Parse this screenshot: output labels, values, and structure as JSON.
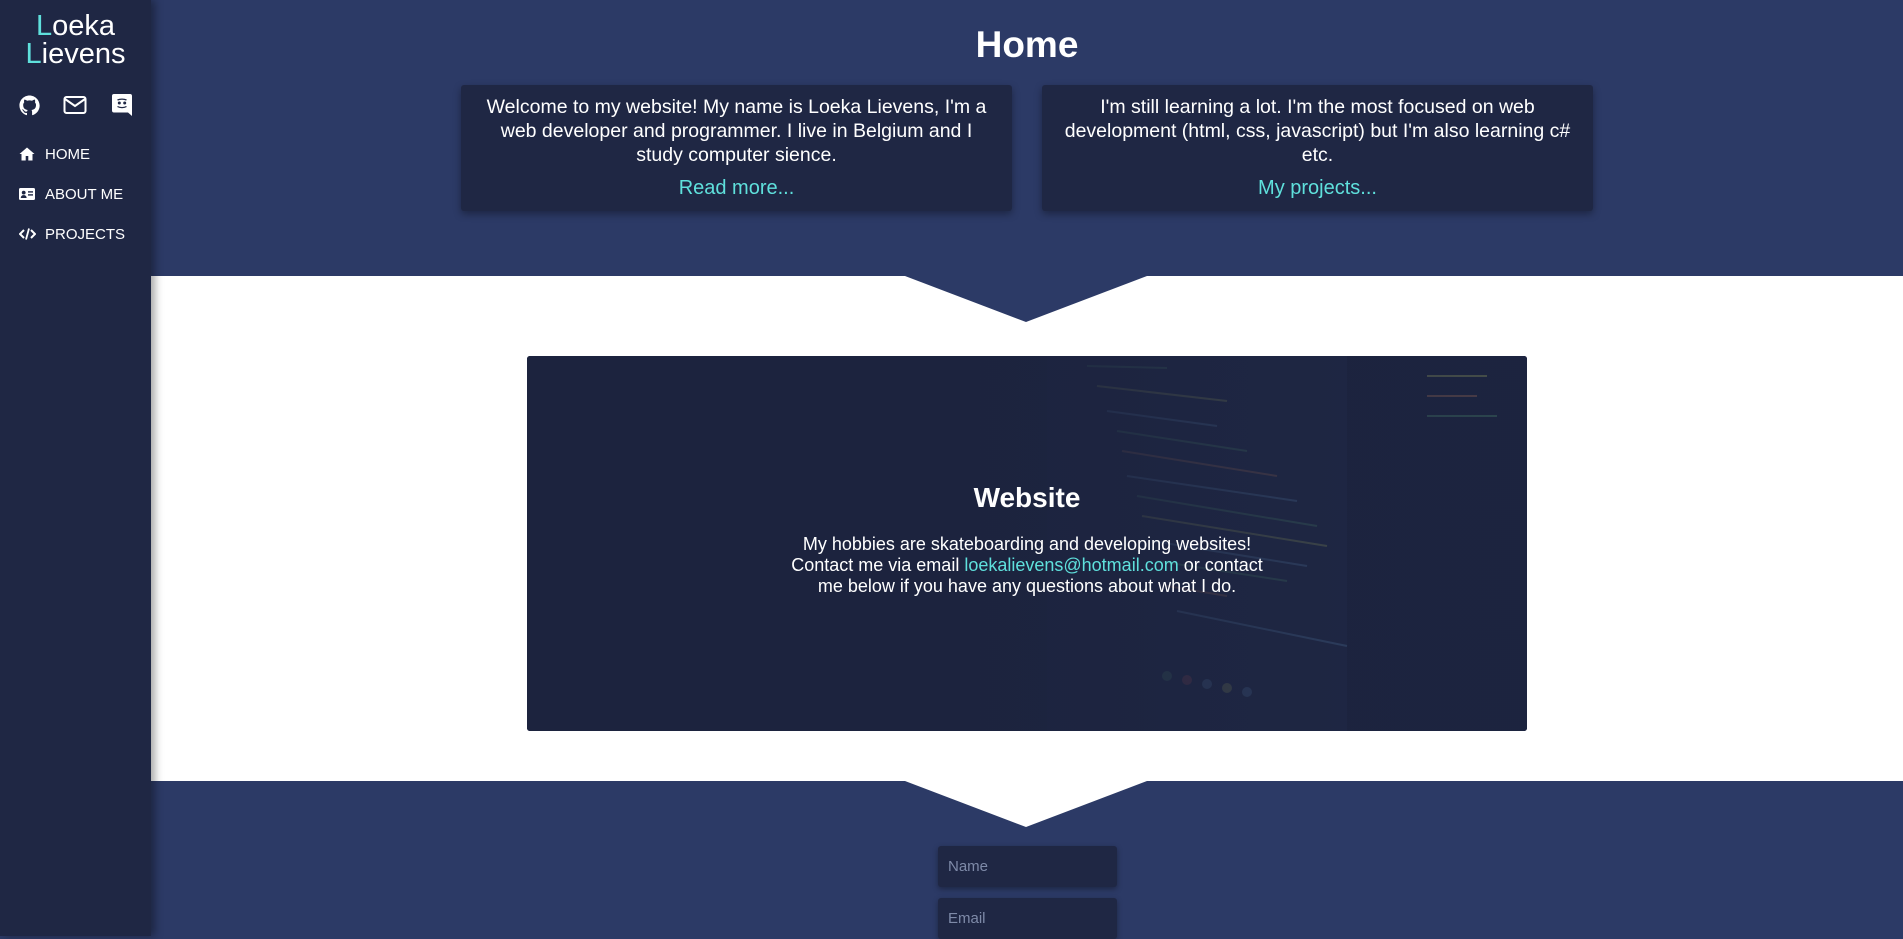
{
  "sidebar": {
    "brand_line1_initial": "L",
    "brand_line1_rest": "oeka",
    "brand_line2_initial": "L",
    "brand_line2_rest": "ievens",
    "social_icons": [
      "github-icon",
      "mail-icon",
      "discord-icon"
    ],
    "nav": [
      {
        "label": "HOME",
        "icon": "home-icon"
      },
      {
        "label": "ABOUT ME",
        "icon": "id-card-icon"
      },
      {
        "label": "PROJECTS",
        "icon": "code-icon"
      }
    ]
  },
  "hero": {
    "title": "Home",
    "cards": [
      {
        "text": "Welcome to my website! My name is Loeka Lievens, I'm a web developer and programmer. I live in Belgium and I study computer sience.",
        "link": "Read more..."
      },
      {
        "text": "I'm still learning a lot. I'm the most focused on web development (html, css, javascript) but I'm also learning c# etc.",
        "link": "My projects..."
      }
    ]
  },
  "feature": {
    "title": "Website",
    "line1": "My hobbies are skateboarding and developing websites!",
    "line2_pre": "Contact me via email ",
    "email": "loekalievens@hotmail.com",
    "line2_post": " or contact",
    "line3": "me below if you have any questions about what I do."
  },
  "contact_form": {
    "name_placeholder": "Name",
    "email_placeholder": "Email"
  },
  "colors": {
    "accent": "#5fe0dc",
    "sidebar_bg": "#1f2744",
    "page_bg": "#2c3a66"
  }
}
